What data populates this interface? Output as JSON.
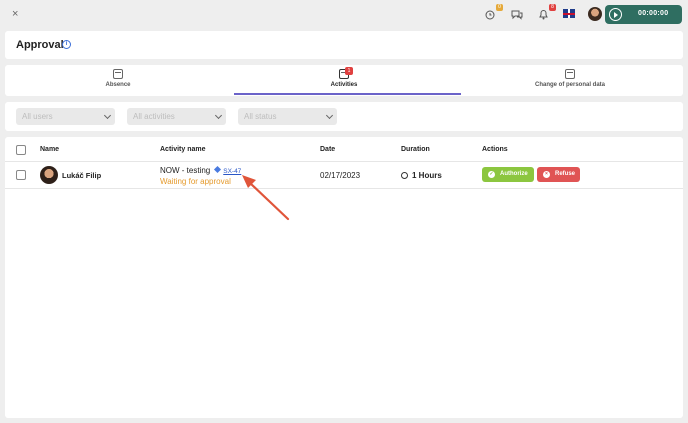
{
  "topbar": {
    "close_label": "×",
    "notification_badge_1": "0",
    "notification_badge_2": "8",
    "timer": "00:00:00"
  },
  "page": {
    "title": "Approval",
    "info_symbol": "i"
  },
  "tabs": [
    {
      "label": "Absence",
      "active": false
    },
    {
      "label": "Activities",
      "active": true,
      "badge": "1"
    },
    {
      "label": "Change of personal data",
      "active": false
    }
  ],
  "filters": {
    "users_placeholder": "All users",
    "activities_placeholder": "All activities",
    "status_placeholder": "All status"
  },
  "table": {
    "headers": {
      "name": "Name",
      "activity": "Activity name",
      "date": "Date",
      "duration": "Duration",
      "actions": "Actions"
    },
    "rows": [
      {
        "name": "Lukáč Filip",
        "activity": "NOW - testing",
        "issue": "SX-47",
        "status": "Waiting for approval",
        "date": "02/17/2023",
        "duration": "1 Hours",
        "authorize_label": "Authorize",
        "refuse_label": "Refuse"
      }
    ]
  },
  "colors": {
    "accent": "#6b63c9",
    "authorize": "#8cc63f",
    "refuse": "#e05454",
    "status_pending": "#e59b2e",
    "timer_bg": "#2f6e61",
    "annotation_arrow": "#e0553a"
  },
  "icons": [
    "close-icon",
    "clock-icon",
    "chat-icon",
    "bell-icon",
    "uk-flag-icon",
    "play-icon",
    "calendar-icon",
    "diamond-icon",
    "stopwatch-icon",
    "check-icon",
    "x-icon",
    "chevron-down-icon"
  ]
}
